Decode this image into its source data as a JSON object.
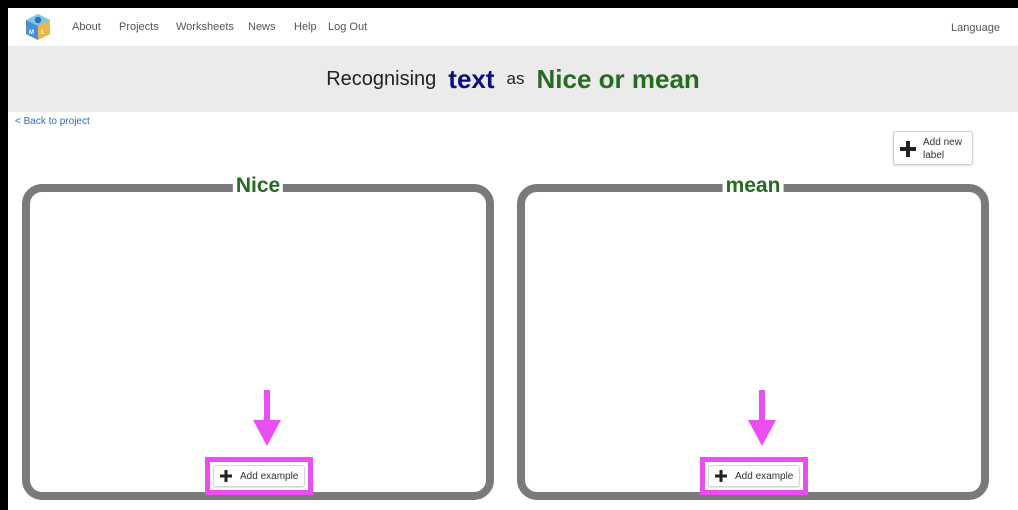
{
  "nav": {
    "items": [
      "About",
      "Projects",
      "Worksheets",
      "News",
      "Help",
      "Log Out"
    ],
    "language": "Language"
  },
  "title": {
    "prefix": "Recognising",
    "type": "text",
    "as": "as",
    "labels": "Nice or mean"
  },
  "back_link": "< Back to project",
  "add_label_button": "Add new label",
  "buckets": [
    {
      "label": "Nice",
      "add_button": "Add example"
    },
    {
      "label": "mean",
      "add_button": "Add example"
    }
  ],
  "colors": {
    "type_text": "#0e0e80",
    "label_text": "#266b1f",
    "bucket_border": "#7a7a7a",
    "highlight": "#ea4df2",
    "title_band": "#ebebeb"
  },
  "icons": [
    "ml-for-kids-logo-icon",
    "plus-icon",
    "down-arrow-icon"
  ]
}
